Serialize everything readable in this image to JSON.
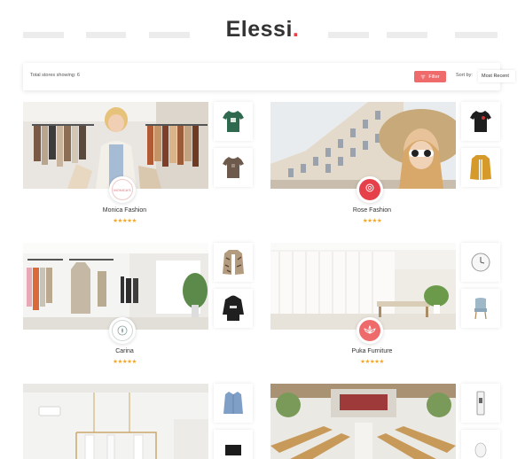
{
  "brand": {
    "name": "Elessi",
    "dot": "."
  },
  "toolbar": {
    "total_label": "Total stores showing: 6",
    "filter_label": "Filter",
    "sort_label": "Sort by:",
    "sort_value": "Most Recent"
  },
  "stores": [
    {
      "name": "Monica Fashion",
      "stars": "★★★★★",
      "badge_text": "MONICA'S",
      "badge_color": "#ffffff",
      "thumbs": [
        "green-tshirt",
        "brown-tshirt"
      ]
    },
    {
      "name": "Rose Fashion",
      "stars": "★★★★",
      "badge_text": "ROSE",
      "badge_color": "#e6404a",
      "thumbs": [
        "black-tshirt",
        "mustard-jacket"
      ]
    },
    {
      "name": "Carina",
      "stars": "★★★★★",
      "badge_text": "",
      "badge_color": "#ffffff",
      "thumbs": [
        "patterned-jacket",
        "black-hoodie"
      ]
    },
    {
      "name": "Puka Furniture",
      "stars": "★★★★★",
      "badge_text": "",
      "badge_color": "#ef6b6b",
      "thumbs": [
        "wall-clock",
        "blue-chair"
      ]
    },
    {
      "name": "",
      "stars": "",
      "badge_text": "",
      "badge_color": "#ffffff",
      "thumbs": [
        "denim-shirt",
        "black-item"
      ]
    },
    {
      "name": "",
      "stars": "",
      "badge_text": "",
      "badge_color": "#ffffff",
      "thumbs": [
        "wall-phone",
        "white-mouse"
      ]
    }
  ],
  "colors": {
    "accent": "#e6404a",
    "filter": "#ef6b6b",
    "stars": "#f5a623"
  }
}
